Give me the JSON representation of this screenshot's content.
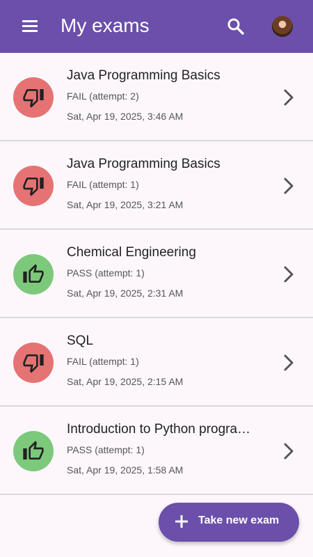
{
  "header": {
    "title": "My exams"
  },
  "colors": {
    "appbar": "#6b4faa",
    "fail": "#e57373",
    "pass": "#7cc97b"
  },
  "exams": [
    {
      "title": "Java Programming Basics",
      "result": "FAIL (attempt: 2)",
      "date": "Sat, Apr 19, 2025, 3:46 AM",
      "status": "fail",
      "icon": "thumbs-down-icon"
    },
    {
      "title": "Java Programming Basics",
      "result": "FAIL (attempt: 1)",
      "date": "Sat, Apr 19, 2025, 3:21 AM",
      "status": "fail",
      "icon": "thumbs-down-icon"
    },
    {
      "title": "Chemical Engineering",
      "result": "PASS (attempt: 1)",
      "date": "Sat, Apr 19, 2025, 2:31 AM",
      "status": "pass",
      "icon": "thumbs-up-icon"
    },
    {
      "title": "SQL",
      "result": "FAIL (attempt: 1)",
      "date": "Sat, Apr 19, 2025, 2:15 AM",
      "status": "fail",
      "icon": "thumbs-down-icon"
    },
    {
      "title": "Introduction to Python progra…",
      "result": "PASS (attempt: 1)",
      "date": "Sat, Apr 19, 2025, 1:58 AM",
      "status": "pass",
      "icon": "thumbs-up-icon"
    }
  ],
  "fab": {
    "label": "Take new exam",
    "icon": "plus-icon"
  }
}
